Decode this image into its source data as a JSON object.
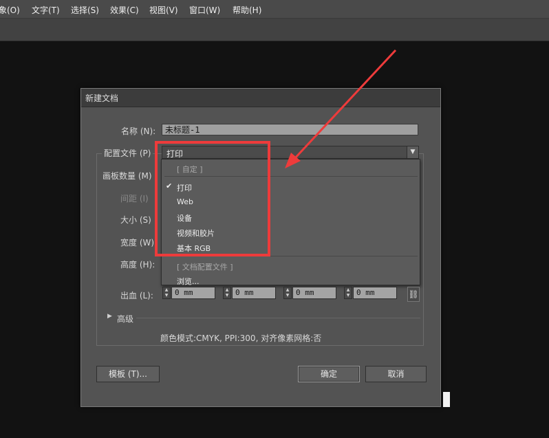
{
  "menubar": {
    "items": [
      "象(O)",
      "文字(T)",
      "选择(S)",
      "效果(C)",
      "视图(V)",
      "窗口(W)",
      "帮助(H)"
    ]
  },
  "dialog": {
    "title": "新建文档",
    "name_label": "名称 (N):",
    "name_value": "未标题-1",
    "profile_label": "配置文件 (P)",
    "profile_value": "打印",
    "artboards_label": "画板数量 (M)",
    "spacing_label": "间距 (I)",
    "size_label": "大小 (S)",
    "width_label": "宽度 (W)",
    "height_label": "高度 (H):",
    "bleed_label": "出血 (L):",
    "bleed_values": [
      "0 mm",
      "0 mm",
      "0 mm",
      "0 mm"
    ],
    "advanced_label": "高级",
    "summary": "颜色模式:CMYK, PPI:300, 对齐像素网格:否",
    "template_button": "模板 (T)...",
    "ok_button": "确定",
    "cancel_button": "取消"
  },
  "profile_dropdown": {
    "custom_header": "[ 自定 ]",
    "options": [
      "打印",
      "Web",
      "设备",
      "视频和胶片",
      "基本 RGB"
    ],
    "selected": "打印",
    "doc_profiles_header": "[ 文档配置文件 ]",
    "browse": "浏览..."
  },
  "annotation": {
    "color": "#ee3b3b"
  }
}
